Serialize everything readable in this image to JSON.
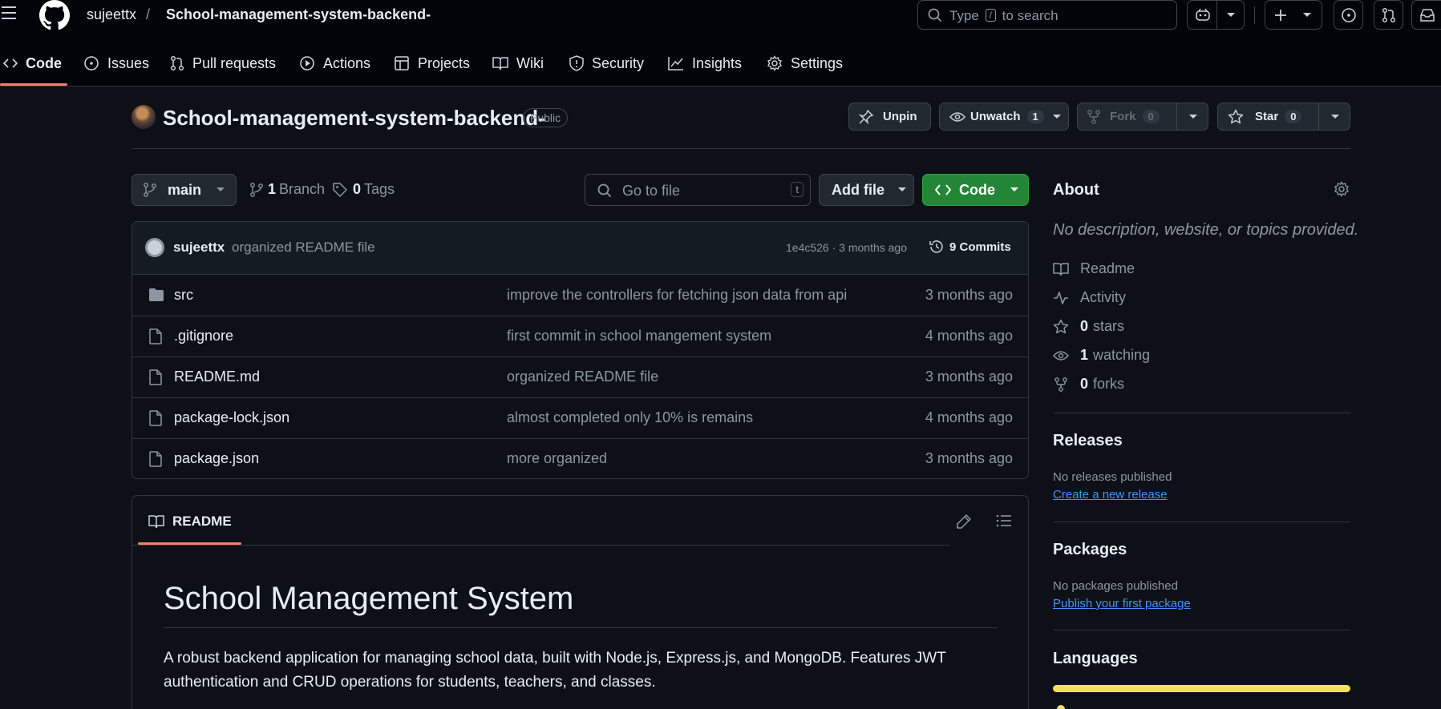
{
  "header": {
    "owner": "sujeettx",
    "separator": "/",
    "repo": "School-management-system-backend-",
    "search_prefix": "Type",
    "search_key": "/",
    "search_suffix": "to search"
  },
  "tabs": [
    {
      "label": "Code",
      "icon": "code-icon",
      "selected": true
    },
    {
      "label": "Issues",
      "icon": "issue-opened-icon"
    },
    {
      "label": "Pull requests",
      "icon": "git-pull-request-icon"
    },
    {
      "label": "Actions",
      "icon": "play-icon"
    },
    {
      "label": "Projects",
      "icon": "table-icon"
    },
    {
      "label": "Wiki",
      "icon": "book-icon"
    },
    {
      "label": "Security",
      "icon": "shield-icon"
    },
    {
      "label": "Insights",
      "icon": "graph-icon"
    },
    {
      "label": "Settings",
      "icon": "gear-icon"
    }
  ],
  "repo": {
    "title": "School-management-system-backend-",
    "visibility": "Public",
    "unpin_label": "Unpin",
    "watch_label": "Unwatch",
    "watch_count": "1",
    "fork_label": "Fork",
    "fork_count": "0",
    "star_label": "Star",
    "star_count": "0"
  },
  "filenav": {
    "branch": "main",
    "branch_count": "1",
    "branch_label": "Branch",
    "tag_count": "0",
    "tag_label": "Tags",
    "goto_placeholder": "Go to file",
    "goto_key": "t",
    "add_file_label": "Add file",
    "code_label": "Code"
  },
  "latest_commit": {
    "author": "sujeettx",
    "message": "organized README file",
    "sha_time": "1e4c526 · 3 months ago",
    "commit_count": "9 Commits"
  },
  "files": [
    {
      "name": "src",
      "type": "folder",
      "message": "improve the controllers for fetching json data from api",
      "date": "3 months ago"
    },
    {
      "name": ".gitignore",
      "type": "file",
      "message": "first commit in school mangement system",
      "date": "4 months ago"
    },
    {
      "name": "README.md",
      "type": "file",
      "message": "organized README file",
      "date": "3 months ago"
    },
    {
      "name": "package-lock.json",
      "type": "file",
      "message": "almost completed only 10% is remains",
      "date": "4 months ago"
    },
    {
      "name": "package.json",
      "type": "file",
      "message": "more organized",
      "date": "3 months ago"
    }
  ],
  "readme": {
    "tab_label": "README",
    "heading": "School Management System",
    "paragraph": "A robust backend application for managing school data, built with Node.js, Express.js, and MongoDB. Features JWT authentication and CRUD operations for students, teachers, and classes."
  },
  "sidebar": {
    "about_heading": "About",
    "about_desc": "No description, website, or topics provided.",
    "readme_label": "Readme",
    "activity_label": "Activity",
    "stars_count": "0",
    "stars_label": "stars",
    "watching_count": "1",
    "watching_label": "watching",
    "forks_count": "0",
    "forks_label": "forks",
    "releases_heading": "Releases",
    "releases_note": "No releases published",
    "releases_link": "Create a new release",
    "packages_heading": "Packages",
    "packages_note": "No packages published",
    "packages_link": "Publish your first package",
    "languages_heading": "Languages",
    "language_color": "#f1e05a"
  },
  "colors": {
    "background": "#0d1117",
    "header": "#010409",
    "accent_underline": "#f78166",
    "code_button": "#238636",
    "link": "#4493f8"
  }
}
